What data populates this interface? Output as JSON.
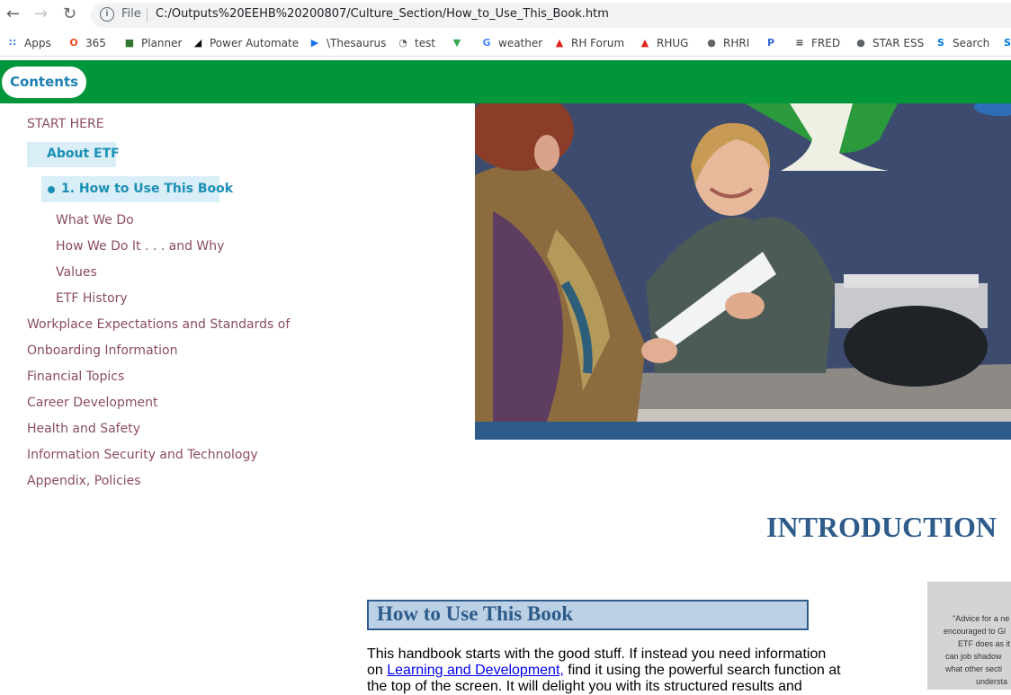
{
  "browser": {
    "back_icon": "back-arrow-icon",
    "forward_icon": "forward-arrow-icon",
    "reload_icon": "reload-icon",
    "scheme_label": "File",
    "url": "C:/Outputs%20EEHB%20200807/Culture_Section/How_to_Use_This_Book.htm"
  },
  "bookmarks": [
    {
      "label": "Apps",
      "icon": "apps-grid-icon",
      "color": "#4285f4"
    },
    {
      "label": "365",
      "icon": "office-icon",
      "color": "#e94c1e"
    },
    {
      "label": "Planner",
      "icon": "planner-icon",
      "color": "#31752f"
    },
    {
      "label": "Power Automate",
      "icon": "power-automate-icon",
      "color": "#0b0b0b"
    },
    {
      "label": "\\Thesaurus",
      "icon": "thesaurus-icon",
      "color": "#1a73e8"
    },
    {
      "label": "test",
      "icon": "gauge-icon",
      "color": "#5f6368"
    },
    {
      "label": "",
      "icon": "maps-pin-icon",
      "color": "#34a853"
    },
    {
      "label": "weather",
      "icon": "google-icon",
      "color": "#4285f4"
    },
    {
      "label": "RH Forum",
      "icon": "adobe-icon",
      "color": "#e2231a"
    },
    {
      "label": "RHUG",
      "icon": "adobe-icon",
      "color": "#e2231a"
    },
    {
      "label": "RHRI",
      "icon": "globe-icon",
      "color": "#5f6368"
    },
    {
      "label": "",
      "icon": "pc-icon",
      "color": "#3367d6"
    },
    {
      "label": "FRED",
      "icon": "document-icon",
      "color": "#3c4043"
    },
    {
      "label": "STAR ESS",
      "icon": "globe-icon",
      "color": "#5f6368"
    },
    {
      "label": "Search",
      "icon": "sharepoint-icon",
      "color": "#0078d4"
    },
    {
      "label": "",
      "icon": "sharepoint-icon",
      "color": "#0078d4"
    }
  ],
  "header": {
    "contents_label": "Contents",
    "bar_color": "#009639"
  },
  "toc": {
    "start_here": "START HERE",
    "about_etf": "About ETF",
    "current": "1. How to Use This Book",
    "children": [
      "What We Do",
      "How We Do It . . . and Why",
      "Values",
      "ETF History"
    ],
    "sections": [
      "Workplace Expectations and Standards of",
      "Onboarding Information",
      "Financial Topics",
      "Career Development",
      "Health and Safety",
      "Information Security and Technology",
      "Appendix, Policies"
    ]
  },
  "content": {
    "heading": "INTRODUCTION",
    "section_title": "How to Use This Book",
    "para_line1": "This handbook starts with the good stuff. If instead you need information",
    "para_on": "on ",
    "para_link": "Learning and Development,",
    "para_line2_rest": " find it using the powerful search function at",
    "para_line3": "the top of the screen. It will delight you with its structured results and",
    "quote_lines": [
      "\"Advice for a ne",
      "encouraged to Gl",
      "ETF does as it",
      "can job shadow",
      "what other secti",
      "understa"
    ]
  }
}
